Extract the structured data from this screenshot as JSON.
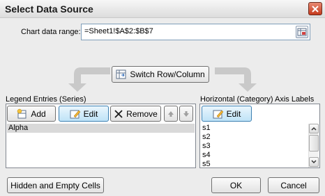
{
  "window": {
    "title": "Select Data Source"
  },
  "chart_range": {
    "label": "Chart data range:",
    "value": "=Sheet1!$A$2:$B$7"
  },
  "switch_button": {
    "label": "Switch Row/Column"
  },
  "legend": {
    "heading": "Legend Entries (Series)",
    "add_label": "Add",
    "edit_label": "Edit",
    "remove_label": "Remove",
    "series": [
      "Alpha"
    ]
  },
  "axis": {
    "heading": "Horizontal (Category) Axis Labels",
    "edit_label": "Edit",
    "items": [
      "s1",
      "s2",
      "s3",
      "s4",
      "s5"
    ]
  },
  "footer": {
    "hidden_cells_label": "Hidden and Empty Cells",
    "ok_label": "OK",
    "cancel_label": "Cancel"
  },
  "colors": {
    "close_button": "#c5391c",
    "selection": "#d9d9d9",
    "accent": "#3c7fb1"
  }
}
